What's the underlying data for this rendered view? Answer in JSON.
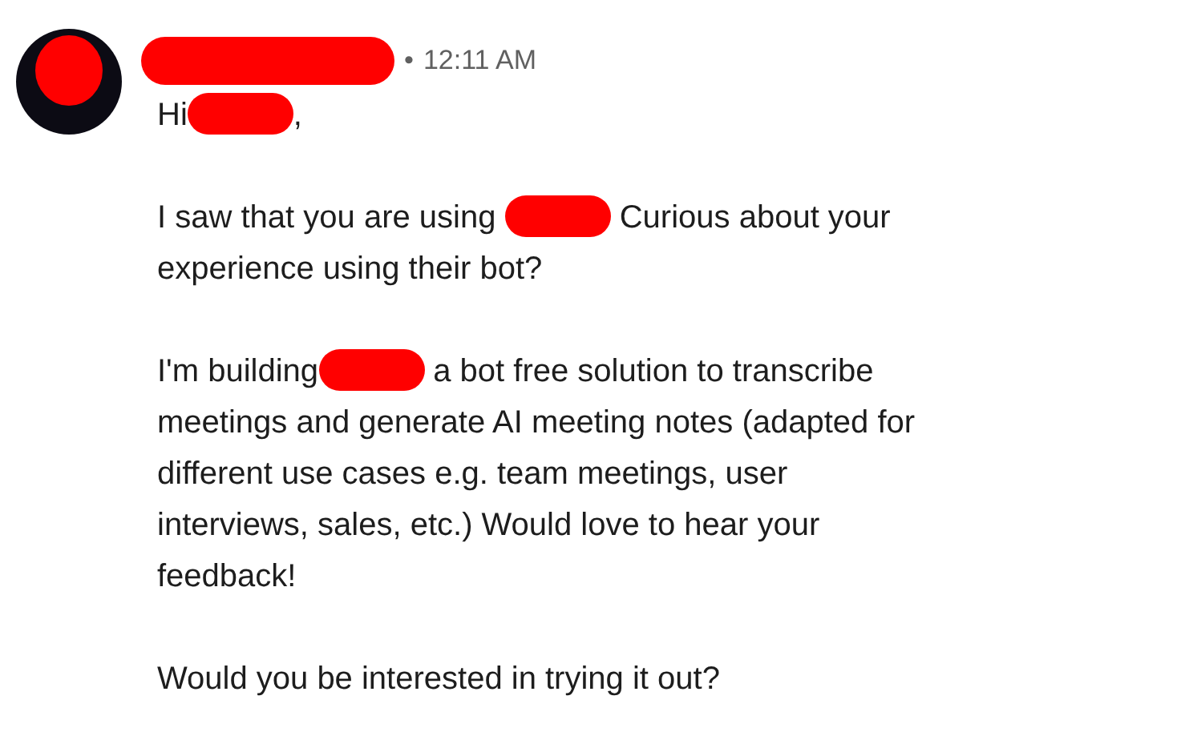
{
  "message": {
    "separator": "•",
    "time": "12:11 AM",
    "paragraphs": [
      {
        "lines": [
          [
            {
              "kind": "text",
              "text": "Hi"
            },
            {
              "kind": "redaction"
            },
            {
              "kind": "text",
              "text": ","
            }
          ]
        ]
      },
      {
        "lines": [
          [
            {
              "kind": "text",
              "text": "I saw that you are using "
            },
            {
              "kind": "redaction"
            },
            {
              "kind": "text",
              "text": " Curious about your"
            }
          ],
          [
            {
              "kind": "text",
              "text": "experience using their bot?"
            }
          ]
        ]
      },
      {
        "lines": [
          [
            {
              "kind": "text",
              "text": "I'm building"
            },
            {
              "kind": "redaction"
            },
            {
              "kind": "text",
              "text": " a bot free solution to transcribe"
            }
          ],
          [
            {
              "kind": "text",
              "text": "meetings and generate AI meeting notes (adapted for"
            }
          ],
          [
            {
              "kind": "text",
              "text": "different use cases e.g. team meetings, user"
            }
          ],
          [
            {
              "kind": "text",
              "text": "interviews, sales, etc.) Would love to hear your"
            }
          ],
          [
            {
              "kind": "text",
              "text": "feedback!"
            }
          ]
        ]
      },
      {
        "lines": [
          [
            {
              "kind": "text",
              "text": "Would you be interested in trying it out?"
            }
          ]
        ]
      }
    ]
  }
}
